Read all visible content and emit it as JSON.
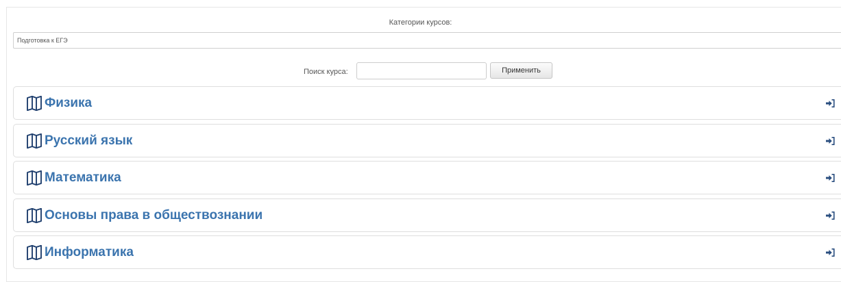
{
  "categories": {
    "label": "Категории курсов:",
    "selected": "Подготовка к ЕГЭ"
  },
  "search": {
    "label": "Поиск курса:",
    "value": "",
    "placeholder": "",
    "apply_label": "Применить"
  },
  "courses": [
    {
      "title": "Физика",
      "icon": "map-icon",
      "action_icon": "enter-icon"
    },
    {
      "title": "Русский язык",
      "icon": "map-icon",
      "action_icon": "enter-icon"
    },
    {
      "title": "Математика",
      "icon": "map-icon",
      "action_icon": "enter-icon"
    },
    {
      "title": "Основы права в обществознании",
      "icon": "map-icon",
      "action_icon": "enter-icon"
    },
    {
      "title": "Информатика",
      "icon": "map-icon",
      "action_icon": "enter-icon"
    }
  ],
  "colors": {
    "course_title": "#3b74ae",
    "icon": "#1f3f6e",
    "border": "#dedede"
  }
}
